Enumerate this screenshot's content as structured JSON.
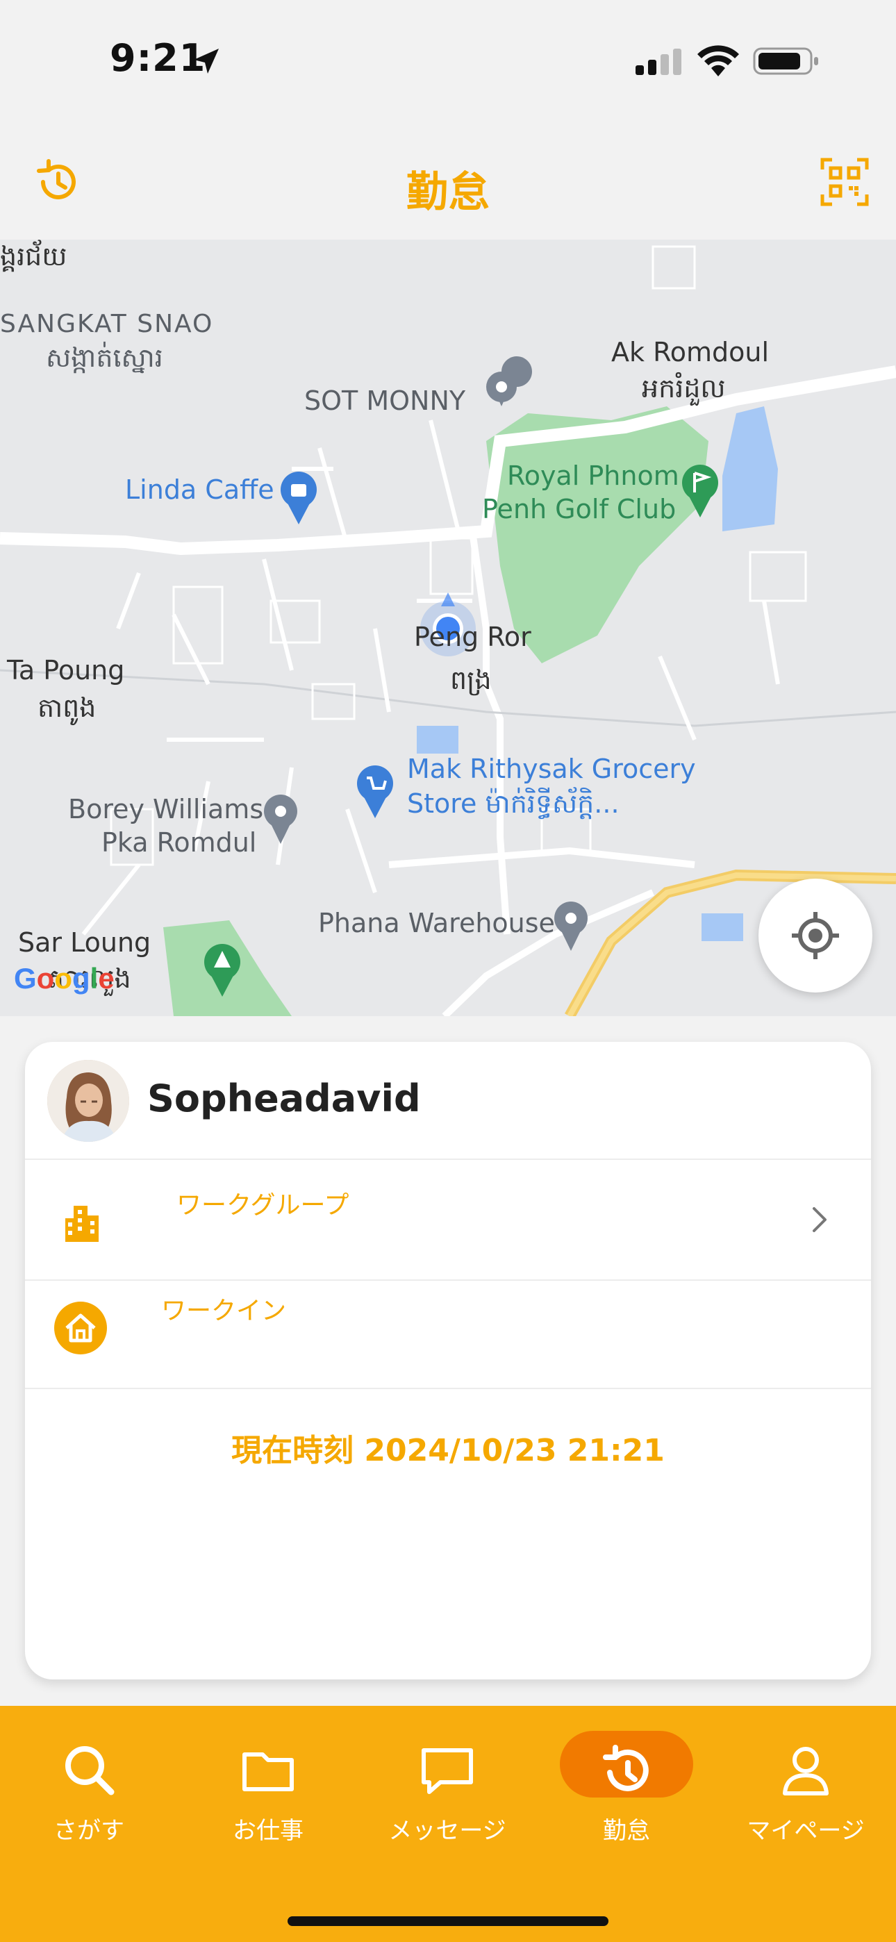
{
  "status_bar": {
    "time": "9:21"
  },
  "header": {
    "title": "勤怠"
  },
  "map": {
    "labels": {
      "sangkat_snao_en": "SANGKAT SNAO",
      "sangkat_snao_km": "សង្កាត់ស្នោរ",
      "top_left_km": "ង្គរជ័យ",
      "ak_romdoul_en": "Ak Romdoul",
      "ak_romdoul_km": "អករំដួល",
      "sot_monny": "SOT MONNY",
      "golf_line1": "Royal Phnom",
      "golf_line2": "Penh Golf Club",
      "linda_caffe": "Linda Caffe",
      "peng_ror_en": "Peng Ror",
      "peng_ror_km": "ពង្រ",
      "ta_poung_en": "Ta Poung",
      "ta_poung_km": "តាពូង",
      "grocery_line1": "Mak Rithysak Grocery",
      "grocery_line2": "Store ម៉ាក់រិទ្ធីស័ក្តិ...",
      "borey_line1": "Borey Williams",
      "borey_line2": "Pka Romdul",
      "phana": "Phana Warehouse",
      "sar_loung_en": "Sar Loung",
      "sar_loung_km": "សារលួង",
      "google": "Google"
    }
  },
  "card": {
    "user_name": "Sopheadavid",
    "workgroup_label": "ワークグループ",
    "workin_label": "ワークイン",
    "current_time": "現在時刻 2024/10/23 21:21"
  },
  "tabs": [
    {
      "label": "さがす",
      "icon": "search-icon"
    },
    {
      "label": "お仕事",
      "icon": "folder-icon"
    },
    {
      "label": "メッセージ",
      "icon": "chat-icon"
    },
    {
      "label": "勤怠",
      "icon": "history-icon",
      "active": true
    },
    {
      "label": "マイページ",
      "icon": "person-icon"
    }
  ],
  "colors": {
    "accent": "#f5a800",
    "tabbar": "#f8ad0e",
    "active_pill": "#f17a00"
  }
}
